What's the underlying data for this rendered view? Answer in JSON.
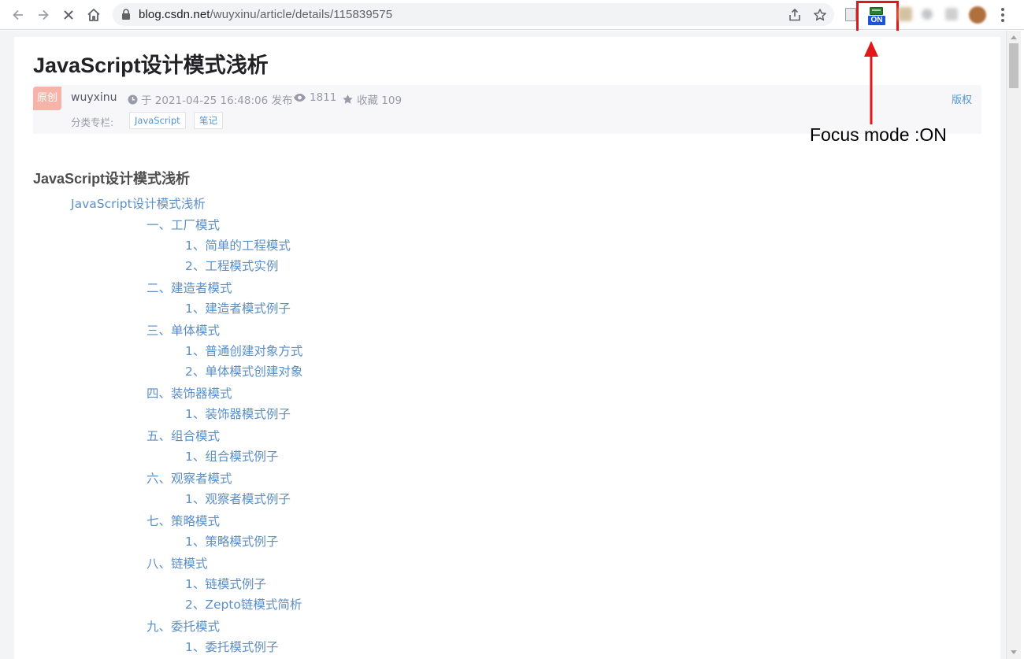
{
  "browser": {
    "url_host": "blog.csdn.net",
    "url_path": "/wuyxinu/article/details/115839575",
    "focus_extension_badge": "ON"
  },
  "annotation": {
    "text": "Focus mode :ON",
    "color": "#e01818"
  },
  "article": {
    "title": "JavaScript设计模式浅析",
    "original_badge": "原创",
    "author": "wuyxinu",
    "published": "于 2021-04-25 16:48:06 发布",
    "views": "1811",
    "favorites": "收藏 109",
    "copyright": "版权",
    "category_label": "分类专栏:",
    "tags": [
      "JavaScript",
      "笔记"
    ],
    "heading": "JavaScript设计模式浅析",
    "toc": [
      {
        "text": "JavaScript设计模式浅析",
        "level": 1
      },
      {
        "text": "一、工厂模式",
        "level": 2
      },
      {
        "text": "1、简单的工程模式",
        "level": 3
      },
      {
        "text": "2、工程模式实例",
        "level": 3
      },
      {
        "text": "二、建造者模式",
        "level": 2
      },
      {
        "text": "1、建造者模式例子",
        "level": 3
      },
      {
        "text": "三、单体模式",
        "level": 2
      },
      {
        "text": "1、普通创建对象方式",
        "level": 3
      },
      {
        "text": "2、单体模式创建对象",
        "level": 3
      },
      {
        "text": "四、装饰器模式",
        "level": 2
      },
      {
        "text": "1、装饰器模式例子",
        "level": 3
      },
      {
        "text": "五、组合模式",
        "level": 2
      },
      {
        "text": "1、组合模式例子",
        "level": 3
      },
      {
        "text": "六、观察者模式",
        "level": 2
      },
      {
        "text": "1、观察者模式例子",
        "level": 3
      },
      {
        "text": "七、策略模式",
        "level": 2
      },
      {
        "text": "1、策略模式例子",
        "level": 3
      },
      {
        "text": "八、链模式",
        "level": 2
      },
      {
        "text": "1、链模式例子",
        "level": 3
      },
      {
        "text": "2、Zepto链模式简析",
        "level": 3
      },
      {
        "text": "九、委托模式",
        "level": 2
      },
      {
        "text": "1、委托模式例子",
        "level": 3
      }
    ]
  }
}
